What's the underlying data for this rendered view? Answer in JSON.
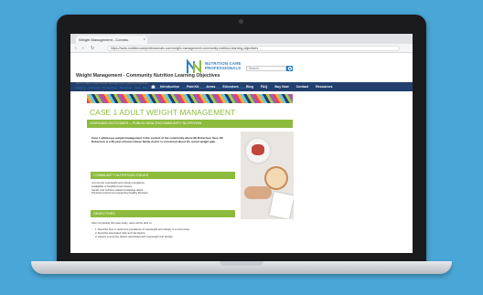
{
  "browser": {
    "tab_title": "Weight Management - Commu",
    "tab_close": "×",
    "url": "https://www.nutritioncareprofessionals.com/weight-management-community-nutrition-learning-objectives"
  },
  "site": {
    "logo_line1": "NUTRITION CARE",
    "logo_line2": "PROFESSIONALS",
    "nav": [
      "Introduction",
      "Paid Kit",
      "Areas",
      "Educators",
      "Blog",
      "FAQ",
      "Buy Now",
      "Contact",
      "Resources"
    ]
  },
  "page": {
    "title": "Weight Management - Community Nutrition Learning Objectives",
    "search_placeholder": "Search ...",
    "breadcrumb": "Home / Case 1 Adult Weight Management / Learning Objectives",
    "subnav": "Learning Outcomes  Perspectives  Resources  Meal Map  Community Story  Your Country & Community's Story  Portfolios  References"
  },
  "case": {
    "title": "CASE 1 ADULT WEIGHT MANAGEMENT",
    "learning_outcomes": "LEARNING OUTCOMES – PUBLIC HEALTH/COMMUNITY NUTRITION",
    "intro": "Case 1 addresses weight management in the context of the community where Mr Robertson lives. Mr Robertson is a 66-year-old man whose family doctor is concerned about his recent weight gain.",
    "cni_heading": "COMMUNITY NUTRITION ISSUES",
    "issues": [
      "Community overweight and obesity prevalence",
      "Availability of healthful food choices",
      "Social- and nutrition-related knowledge deficit",
      "Physical environment supporting healthy lifestyles"
    ],
    "objectives_heading": "OBJECTIVES",
    "objectives_intro": "After completing this case study, users will be able to:",
    "objectives": [
      "1. Describe how to determine prevalence of overweight and obesity in a community.",
      "2. Describe associated risks and risk factors.",
      "3. Assess community factors associated with overweight and obesity."
    ]
  },
  "colors": {
    "background": "#4aa6d6",
    "nav": "#223f6e",
    "accent_green": "#8dbb3d",
    "brand_blue": "#2b7fc1"
  }
}
